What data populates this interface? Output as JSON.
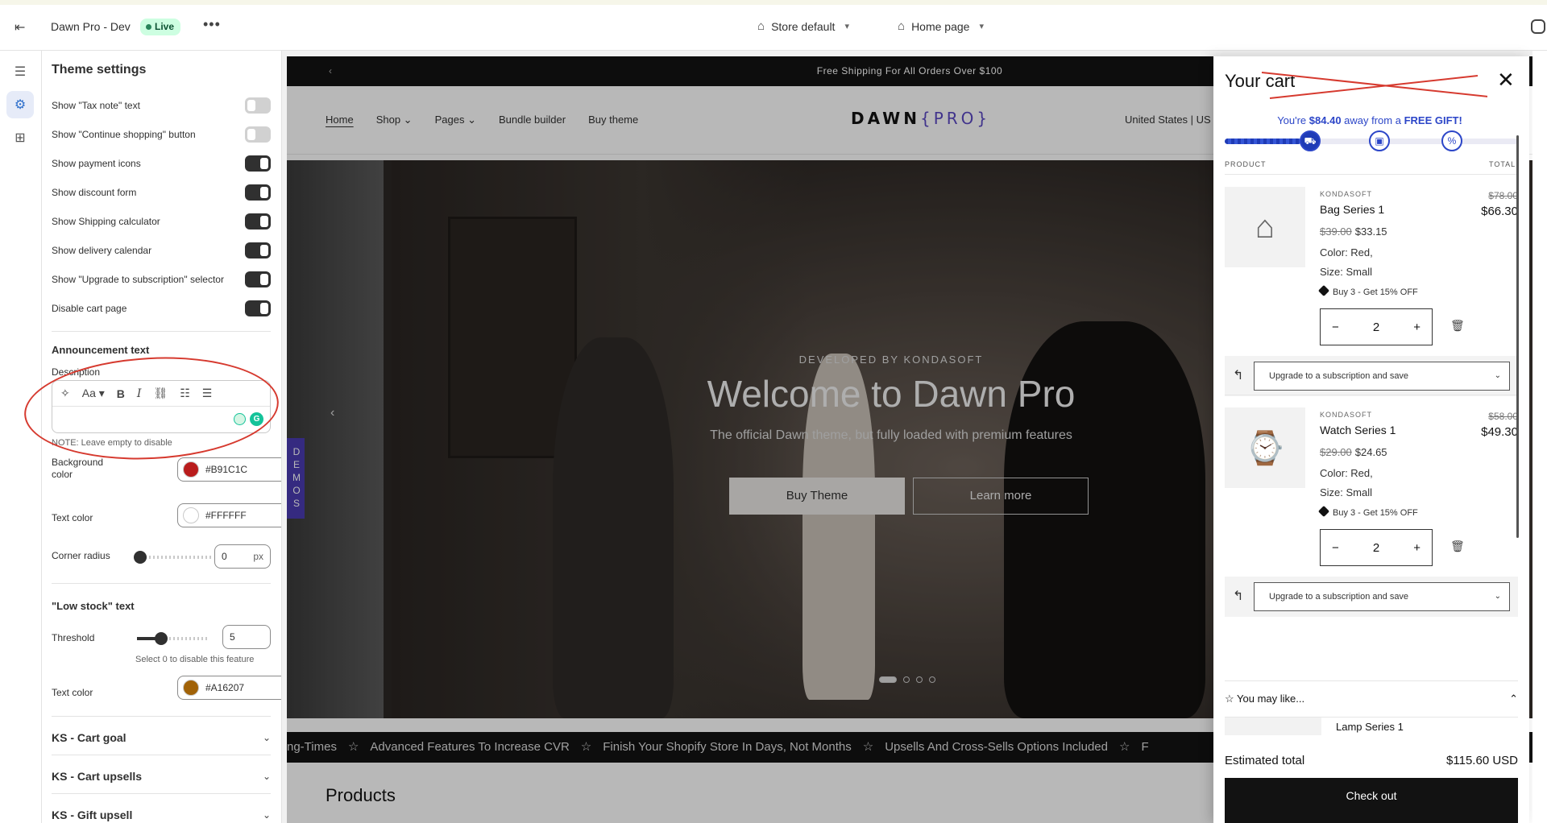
{
  "topbar": {
    "theme_name": "Dawn Pro - Dev",
    "live_badge": "Live",
    "more": "•••",
    "store_select": "Store default",
    "page_select": "Home page"
  },
  "panel": {
    "title": "Theme settings",
    "toggles": [
      {
        "label": "Show \"Tax note\" text",
        "on": false
      },
      {
        "label": "Show \"Continue shopping\" button",
        "on": false
      },
      {
        "label": "Show payment icons",
        "on": true
      },
      {
        "label": "Show discount form",
        "on": true
      },
      {
        "label": "Show Shipping calculator",
        "on": true
      },
      {
        "label": "Show delivery calendar",
        "on": true
      },
      {
        "label": "Show \"Upgrade to subscription\" selector",
        "on": true
      },
      {
        "label": "Disable cart page",
        "on": true
      }
    ],
    "announcement": {
      "heading": "Announcement text",
      "description_label": "Description",
      "note": "NOTE: Leave empty to disable",
      "bg_label": "Background color",
      "bg_value": "#B91C1C",
      "text_color_label": "Text color",
      "text_color_value": "#FFFFFF",
      "corner_label": "Corner radius",
      "corner_value": "0",
      "corner_unit": "px"
    },
    "low_stock": {
      "heading": "\"Low stock\" text",
      "threshold_label": "Threshold",
      "threshold_value": "5",
      "threshold_help": "Select 0 to disable this feature",
      "text_color_label": "Text color",
      "text_color_value": "#A16207"
    },
    "sections": [
      "KS - Cart goal",
      "KS - Cart upsells",
      "KS - Gift upsell"
    ]
  },
  "store": {
    "announcement": "Free Shipping For All Orders Over $100",
    "nav": [
      "Home",
      "Shop",
      "Pages",
      "Bundle builder",
      "Buy theme"
    ],
    "logo_main": "DAWN",
    "logo_pro": "{PRO}",
    "locale": "United States | US",
    "demos": "DEMOS",
    "hero": {
      "kicker": "DEVELOPED BY KONDASOFT",
      "title": "Welcome to Dawn Pro",
      "subtitle": "The official Dawn theme, but fully loaded with premium features",
      "btn_primary": "Buy Theme",
      "btn_secondary": "Learn more"
    },
    "marquee": [
      "ng-Times",
      "Advanced Features To Increase CVR",
      "Finish Your Shopify Store In Days, Not Months",
      "Upsells And Cross-Sells Options Included",
      "F"
    ],
    "products_heading": "Products"
  },
  "cart": {
    "title": "Your cart",
    "goal_prefix": "You're ",
    "goal_amount": "$84.40",
    "goal_middle": " away from a ",
    "goal_reward": "FREE GIFT!",
    "goal_progress": 0.26,
    "col_product": "PRODUCT",
    "col_total": "TOTAL",
    "items": [
      {
        "vendor": "KONDASOFT",
        "name": "Bag Series 1",
        "compare_price": "$39.00",
        "price": "$33.15",
        "color": "Color: Red,",
        "size": "Size: Small",
        "discount": "Buy 3 - Get 15% OFF",
        "qty": "2",
        "total_compare": "$78.00",
        "total": "$66.30",
        "upgrade": "Upgrade to a subscription and save"
      },
      {
        "vendor": "KONDASOFT",
        "name": "Watch Series 1",
        "compare_price": "$29.00",
        "price": "$24.65",
        "color": "Color: Red,",
        "size": "Size: Small",
        "discount": "Buy 3 - Get 15% OFF",
        "qty": "2",
        "total_compare": "$58.00",
        "total": "$49.30",
        "upgrade": "Upgrade to a subscription and save"
      }
    ],
    "may_like": "You may like...",
    "upsell_item": "Lamp Series 1",
    "estimated_label": "Estimated total",
    "estimated_value": "$115.60 USD",
    "checkout": "Check out"
  }
}
